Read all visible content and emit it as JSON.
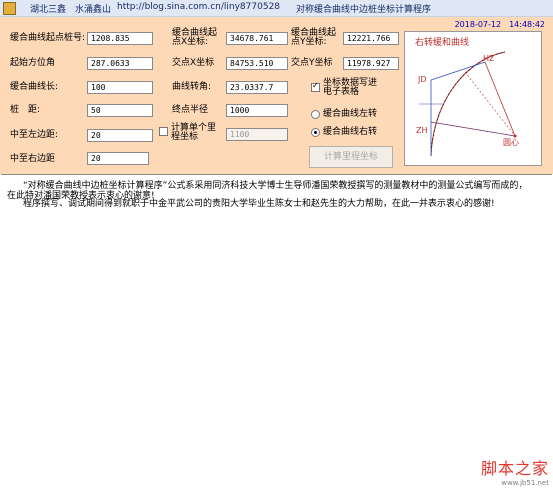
{
  "titlebar": {
    "author": "湖北三鑫　水涌鑫山",
    "blog": "http://blog.sina.com.cn/liny8770528",
    "title": "对称缓合曲线中边桩坐标计算程序"
  },
  "clock": "2018-07-12　14:48:42",
  "form": {
    "start_km_label": "缓合曲线起点桩号:",
    "start_km": "1208.835",
    "start_x_label": "缓合曲线起点X坐标:",
    "start_x": "34678.761",
    "start_y_label": "缓合曲线起点Y坐标:",
    "start_y": "12221.766",
    "azimuth_label": "起始方位角",
    "azimuth": "287.0633",
    "jd_x_label": "交点X坐标",
    "jd_x": "84753.510",
    "jd_y_label": "交点Y坐标",
    "jd_y": "11978.927",
    "spiral_len_label": "缓合曲线长:",
    "spiral_len": "100",
    "deflection_label": "曲线转角:",
    "deflection": "23.0337.7",
    "pile_dist_label": "桩　距:",
    "pile_dist": "50",
    "end_radius_label": "终点半径",
    "end_radius": "1000",
    "left_offset_label": "中至左边距:",
    "left_offset": "20",
    "single_pile_label": "计算单个里程坐标",
    "single_pile": "1100",
    "right_offset_label": "中至右边距",
    "right_offset": "20",
    "export_label": "坐标数据写进电子表格",
    "left_turn_label": "缓合曲线左转",
    "right_turn_label": "缓合曲线右转",
    "calc_button": "计算里程坐标"
  },
  "diagram": {
    "caption": "右转缓和曲线",
    "hz": "HZ",
    "jd": "JD",
    "zh": "ZH",
    "center": "圆心"
  },
  "output": {
    "line1": "“对称缓合曲线中边桩坐标计算程序”公式系采用同济科技大学博士生导师潘国荣教授撰写的测量教材中的测量公式编写而成的，",
    "line2": "在此特对潘国荣教授表示衷心的谢意!",
    "line3": "程序撰写、调试期间得到就职于中金平武公司的贵阳大学毕业生陈女士和赵先生的大力帮助，在此一并表示衷心的感谢!"
  },
  "watermark": {
    "name": "脚本之家",
    "url": "www.jb51.net"
  },
  "colors": {
    "panel": "#fdd9b8",
    "clock": "#0000c0",
    "watermark": "#e2372c"
  }
}
